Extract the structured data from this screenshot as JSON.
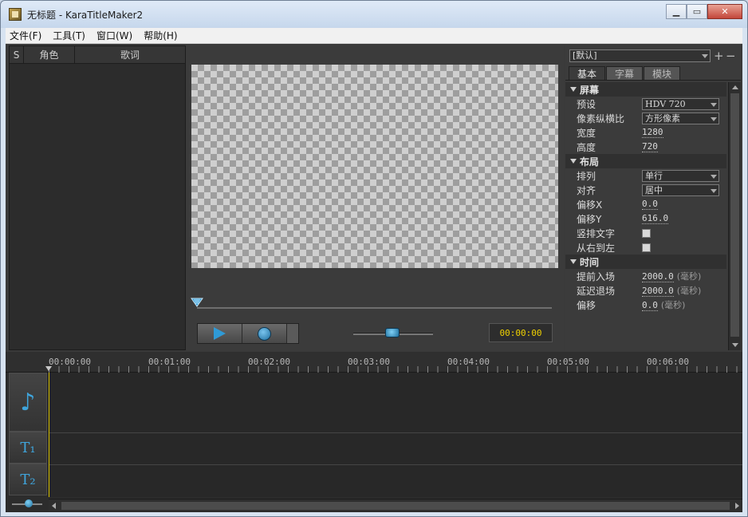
{
  "window": {
    "title": "无标题 - KaraTitleMaker2"
  },
  "menu": [
    {
      "label": "文件(F)"
    },
    {
      "label": "工具(T)"
    },
    {
      "label": "窗口(W)"
    },
    {
      "label": "帮助(H)"
    }
  ],
  "lyric_table": {
    "columns": [
      "S",
      "角色",
      "歌词"
    ],
    "rows": []
  },
  "player": {
    "timecode": "00:00:00",
    "progress": 0,
    "volume": 0.5
  },
  "properties": {
    "preset": "[默认]",
    "tabs": [
      {
        "label": "基本",
        "active": true
      },
      {
        "label": "字幕",
        "active": false
      },
      {
        "label": "模块",
        "active": false
      }
    ],
    "sections": {
      "screen": {
        "title": "屏幕",
        "preset_label": "预设",
        "preset_value": "HDV 720",
        "aspect_label": "像素纵横比",
        "aspect_value": "方形像素",
        "width_label": "宽度",
        "width_value": "1280",
        "height_label": "高度",
        "height_value": "720"
      },
      "layout": {
        "title": "布局",
        "arrange_label": "排列",
        "arrange_value": "单行",
        "align_label": "对齐",
        "align_value": "居中",
        "offset_x_label": "偏移X",
        "offset_x_value": "0.0",
        "offset_y_label": "偏移Y",
        "offset_y_value": "616.0",
        "vertical_label": "竖排文字",
        "vertical_checked": false,
        "rtl_label": "从右到左",
        "rtl_checked": false
      },
      "time": {
        "title": "时间",
        "lead_in_label": "提前入场",
        "lead_in_value": "2000.0",
        "lead_out_label": "延迟退场",
        "lead_out_value": "2000.0",
        "offset_label": "偏移",
        "offset_value": "0.0",
        "unit": "(毫秒)"
      }
    }
  },
  "timeline": {
    "ticks": [
      "00:00:00",
      "00:01:00",
      "00:02:00",
      "00:03:00",
      "00:04:00",
      "00:05:00",
      "00:06:00"
    ],
    "tracks": [
      {
        "icon": "music-note-icon",
        "glyph": "♪"
      },
      {
        "icon": "text-track-1-icon",
        "glyph": "T₁"
      },
      {
        "icon": "text-track-2-icon",
        "glyph": "T₂"
      }
    ]
  },
  "colors": {
    "accent": "#2f9ad6",
    "timecode": "#f1d200",
    "playhead": "#d8c100",
    "panel_bg": "#3b3b3b"
  }
}
